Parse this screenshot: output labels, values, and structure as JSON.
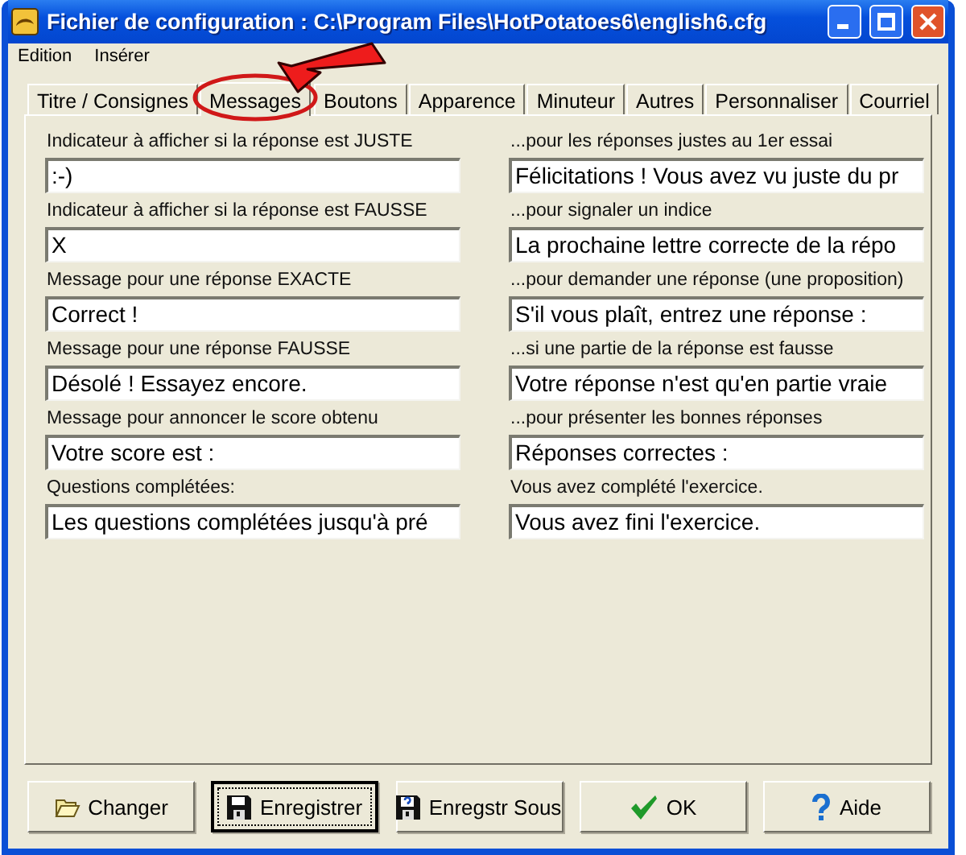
{
  "window": {
    "title": "Fichier de configuration : C:\\Program Files\\HotPotatoes6\\english6.cfg"
  },
  "menu": [
    "Edition",
    "Insérer"
  ],
  "tabs": [
    {
      "label": "Titre / Consignes",
      "selected": false,
      "highlighted": false
    },
    {
      "label": "Messages",
      "selected": true,
      "highlighted": true
    },
    {
      "label": "Boutons",
      "selected": false,
      "highlighted": false
    },
    {
      "label": "Apparence",
      "selected": false,
      "highlighted": false
    },
    {
      "label": "Minuteur",
      "selected": false,
      "highlighted": false
    },
    {
      "label": "Autres",
      "selected": false,
      "highlighted": false
    },
    {
      "label": "Personnaliser",
      "selected": false,
      "highlighted": false
    },
    {
      "label": "Courriel",
      "selected": false,
      "highlighted": false
    }
  ],
  "fields": [
    {
      "label": "Indicateur à afficher si la réponse est JUSTE",
      "value": ":-)"
    },
    {
      "label": "...pour les réponses justes au 1er essai",
      "value": "Félicitations ! Vous avez vu juste du pr"
    },
    {
      "label": "Indicateur à afficher si la réponse est FAUSSE",
      "value": "X"
    },
    {
      "label": "...pour signaler un indice",
      "value": "La prochaine lettre correcte de la répo"
    },
    {
      "label": "Message pour une réponse EXACTE",
      "value": "Correct !"
    },
    {
      "label": "...pour demander une réponse (une proposition)",
      "value": "S'il vous plaît, entrez une réponse :"
    },
    {
      "label": "Message pour une réponse FAUSSE",
      "value": "Désolé ! Essayez encore."
    },
    {
      "label": "...si une partie de la réponse est fausse",
      "value": "Votre réponse n'est qu'en partie vraie"
    },
    {
      "label": "Message pour annoncer le score obtenu",
      "value": "Votre score est :"
    },
    {
      "label": "...pour présenter les bonnes réponses",
      "value": "Réponses correctes :"
    },
    {
      "label": "Questions complétées:",
      "value": "Les questions complétées jusqu'à pré"
    },
    {
      "label": "Vous avez complété l'exercice.",
      "value": "Vous avez fini l'exercice."
    }
  ],
  "buttons": [
    {
      "label": "Changer",
      "kind": "open",
      "focused": false
    },
    {
      "label": "Enregistrer",
      "kind": "save",
      "focused": true
    },
    {
      "label": "Enregstr Sous",
      "kind": "saveas",
      "focused": false
    },
    {
      "label": "OK",
      "kind": "ok",
      "focused": false
    },
    {
      "label": "Aide",
      "kind": "help",
      "focused": false
    }
  ]
}
